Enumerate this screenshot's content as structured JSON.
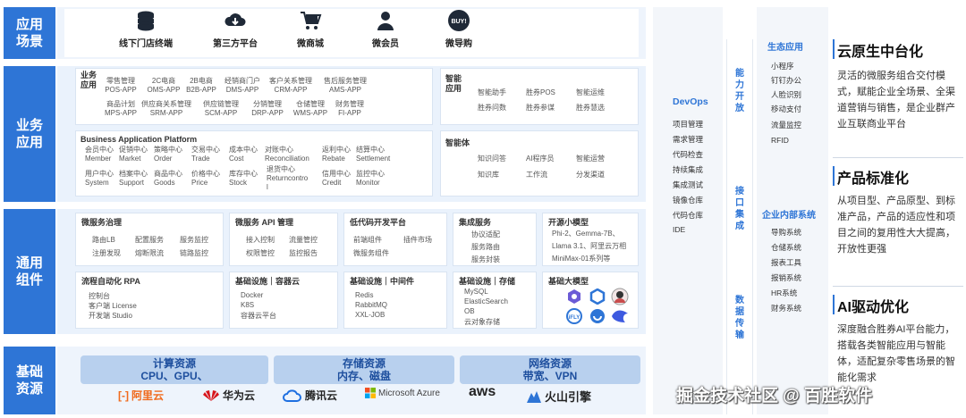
{
  "layers": {
    "app_scene": "应用\n场景",
    "biz_app": "业务\n应用",
    "common": "通用\n组件",
    "base": "基础\n资源"
  },
  "channels": [
    "线下门店终端",
    "第三方平台",
    "微商城",
    "微会员",
    "微导购"
  ],
  "buy_badge": "BUY!",
  "biz": {
    "title": "业务\n应用",
    "row1": [
      "零售管理\nPOS-APP",
      "2C电商\nOMS-APP",
      "2B电商\nB2B-APP",
      "经销商门户\nDMS-APP",
      "客户关系管理\nCRM-APP",
      "售后服务管理\nAMS-APP"
    ],
    "row2": [
      "商品计划\nMPS-APP",
      "供应商关系管理\nSRM-APP",
      "供应链管理\nSCM-APP",
      "分销管理\nDRP-APP",
      "仓储管理\nWMS-APP",
      "财务管理\nFI-APP"
    ]
  },
  "smart_app": {
    "title": "智能\n应用",
    "items": [
      "智能助手",
      "胜券POS",
      "智能运维",
      "胜券问数",
      "胜券参谋",
      "胜券慧选"
    ]
  },
  "bap": {
    "title": "Business Application Platform",
    "row1": [
      "会员中心\nMember",
      "促销中心\nMarket",
      "策略中心\nOrder",
      "交易中心\nTrade",
      "成本中心\nCost",
      "对账中心\nReconciliation",
      "返利中心\nRebate",
      "结算中心\nSettlement"
    ],
    "row2": [
      "用户中心\nSystem",
      "档案中心\nSupport",
      "商品中心\nGoods",
      "价格中心\nPrice",
      "库存中心\nStock",
      "退货中心\nReturncontro\nl",
      "信用中心\nCredit",
      "监控中心\nMonitor"
    ]
  },
  "agent": {
    "title": "智能体",
    "items": [
      "知识问答",
      "AI程序员",
      "智能运营",
      "知识库",
      "工作流",
      "分发渠道"
    ]
  },
  "common": {
    "micro_gov": {
      "title": "微服务治理",
      "items": [
        "路由LB",
        "配置服务",
        "服务监控",
        "注册发现",
        "熔断限流",
        "链路监控"
      ]
    },
    "api_mgmt": {
      "title": "微服务 API 管理",
      "items": [
        "接入控制",
        "流量管控",
        "权限管控",
        "监控报告"
      ]
    },
    "lowcode": {
      "title": "低代码开发平台",
      "items": [
        "前端组件",
        "插件市场",
        "微服务组件"
      ]
    },
    "integration": {
      "title": "集成服务",
      "items": [
        "协议适配",
        "服务路由",
        "服务封装"
      ]
    },
    "oss_model": {
      "title": "开源小模型",
      "items": [
        "Phi-2、Gemma-7B、",
        "Llama 3.1、阿里云万相",
        "MiniMax-01系列等"
      ]
    },
    "rpa": {
      "title": "流程自动化 RPA",
      "items": [
        "控制台",
        "客户端 License",
        "开发端 Studio"
      ]
    },
    "infra_container": {
      "title": "基础设施｜容器云",
      "items": [
        "Docker",
        "K8S",
        "容器云平台"
      ]
    },
    "infra_middleware": {
      "title": "基础设施｜中间件",
      "items": [
        "Redis",
        "RabbitMQ",
        "XXL-JOB"
      ]
    },
    "infra_storage": {
      "title": "基础设施｜存储",
      "items": [
        "MySQL",
        "ElasticSearch",
        "OB",
        "云对象存储"
      ]
    },
    "base_model": {
      "title": "基础大模型"
    }
  },
  "resources": [
    {
      "title": "计算资源",
      "sub": "CPU、GPU、"
    },
    {
      "title": "存储资源",
      "sub": "内存、磁盘"
    },
    {
      "title": "网络资源",
      "sub": "带宽、VPN"
    }
  ],
  "vendors": [
    "阿里云",
    "华为云",
    "腾讯云",
    "Microsoft Azure",
    "aws",
    "火山引擎"
  ],
  "devops": {
    "title": "DevOps",
    "items": [
      "项目管理",
      "需求管理",
      "代码检查",
      "持续集成",
      "集成测试",
      "镜像仓库",
      "代码仓库",
      "IDE"
    ]
  },
  "vertical": {
    "ability": "能力开放",
    "interface": "接口集成",
    "data": "数据传输"
  },
  "eco": {
    "title": "生态应用",
    "items": [
      "小程序",
      "钉钉办公",
      "人脸识别",
      "移动支付",
      "流量监控",
      "RFID"
    ]
  },
  "internal": {
    "title": "企业内部系统",
    "items": [
      "导购系统",
      "仓储系统",
      "报表工具",
      "报销系统",
      "HR系统",
      "财务系统"
    ]
  },
  "features": [
    {
      "title": "云原生中台化",
      "text": "灵活的微服务组合交付模式，赋能企业全场景、全渠道营销与销售，是企业群产业互联商业平台"
    },
    {
      "title": "产品标准化",
      "text": "从项目型、产品原型、到标准产品，产品的适应性和项目之间的复用性大大提高，开放性更强"
    },
    {
      "title": "AI驱动优化",
      "text": "深度融合胜券AI平台能力，搭载各类智能应用与智能体，适配复杂零售场景的智能化需求"
    }
  ],
  "watermark": "掘金技术社区 @ 百胜软件"
}
